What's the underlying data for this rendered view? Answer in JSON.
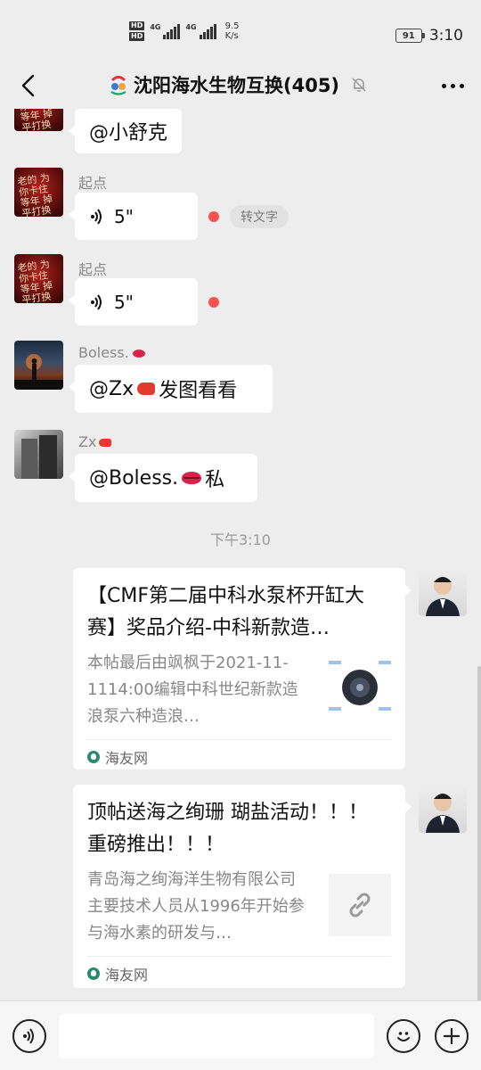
{
  "status_bar": {
    "hd1": "HD",
    "hd2": "HD",
    "net1": "4G",
    "net2": "4G",
    "speed_value": "9.5",
    "speed_unit": "K/s",
    "battery": "91",
    "time": "3:10"
  },
  "nav": {
    "title": "沈阳海水生物互换(405)",
    "icons": [
      "back-icon",
      "group-avatar-icon",
      "mute-bell-icon",
      "more-icon"
    ]
  },
  "messages": {
    "m0": {
      "text": "@小舒克"
    },
    "m1": {
      "sender": "起点",
      "duration": "5\"",
      "convert_label": "转文字"
    },
    "m2": {
      "sender": "起点",
      "duration": "5\""
    },
    "m3": {
      "sender": "Boless.",
      "pre": "@Zx",
      "post": " 发图看看"
    },
    "m4": {
      "sender": "Zx",
      "pre": "@Boless.",
      "post": " 私"
    },
    "time": "下午3:10",
    "card1": {
      "title": "【CMF第二届中科水泵杯开缸大赛】奖品介绍-中科新款造…",
      "desc": "本帖最后由飒枫于2021-11-1114:00编辑中科世纪新款造浪泵六种造浪…",
      "source": "海友网"
    },
    "card2": {
      "title": "顶帖送海之绚珊 瑚盐活动！！！ 重磅推出！！！",
      "desc": "青岛海之绚海洋生物有限公司主要技术人员从1996年开始参与海水素的研发与…",
      "source": "海友网"
    }
  },
  "avatar_scribble": "老的 为\n你卡住\n等年 掉\n平打换",
  "colors": {
    "unread_dot": "#fa5151",
    "background": "#ededed",
    "source_brand": "#2b8a6e"
  }
}
